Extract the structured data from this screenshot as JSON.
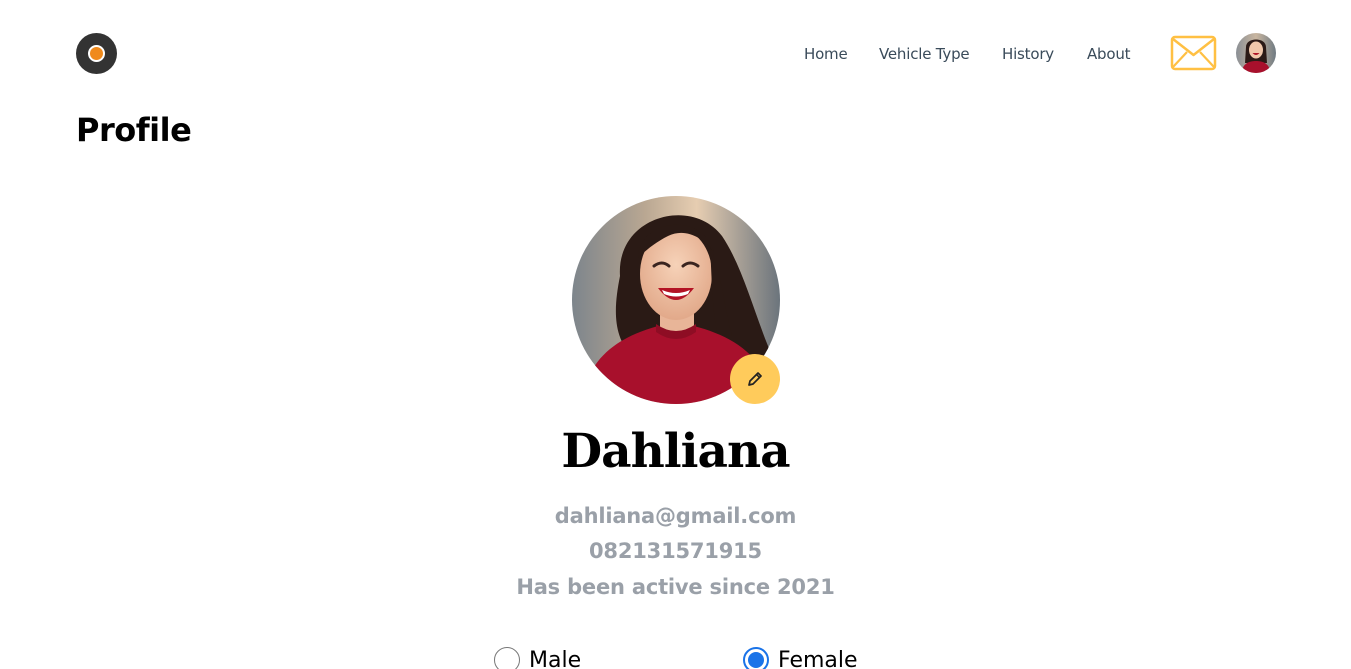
{
  "header": {
    "logo": "logo-icon",
    "nav": [
      {
        "label": "Home"
      },
      {
        "label": "Vehicle Type"
      },
      {
        "label": "History"
      },
      {
        "label": "About"
      }
    ],
    "mail_icon": "mail-icon",
    "avatar": "user-avatar"
  },
  "page": {
    "title": "Profile"
  },
  "profile": {
    "name": "Dahliana",
    "email": "dahliana@gmail.com",
    "phone": "082131571915",
    "active_since": "Has been active since 2021",
    "edit_icon": "pencil-icon"
  },
  "gender": {
    "options": [
      {
        "label": "Male",
        "selected": false
      },
      {
        "label": "Female",
        "selected": true
      }
    ]
  },
  "colors": {
    "accent_yellow": "#ffcb5b",
    "logo_orange": "#f08a1c",
    "logo_dark": "#333333",
    "info_grey": "#9aa0a8",
    "nav_text": "#3a4b5a",
    "radio_blue": "#1a73e8",
    "shirt_red": "#a8102c"
  }
}
